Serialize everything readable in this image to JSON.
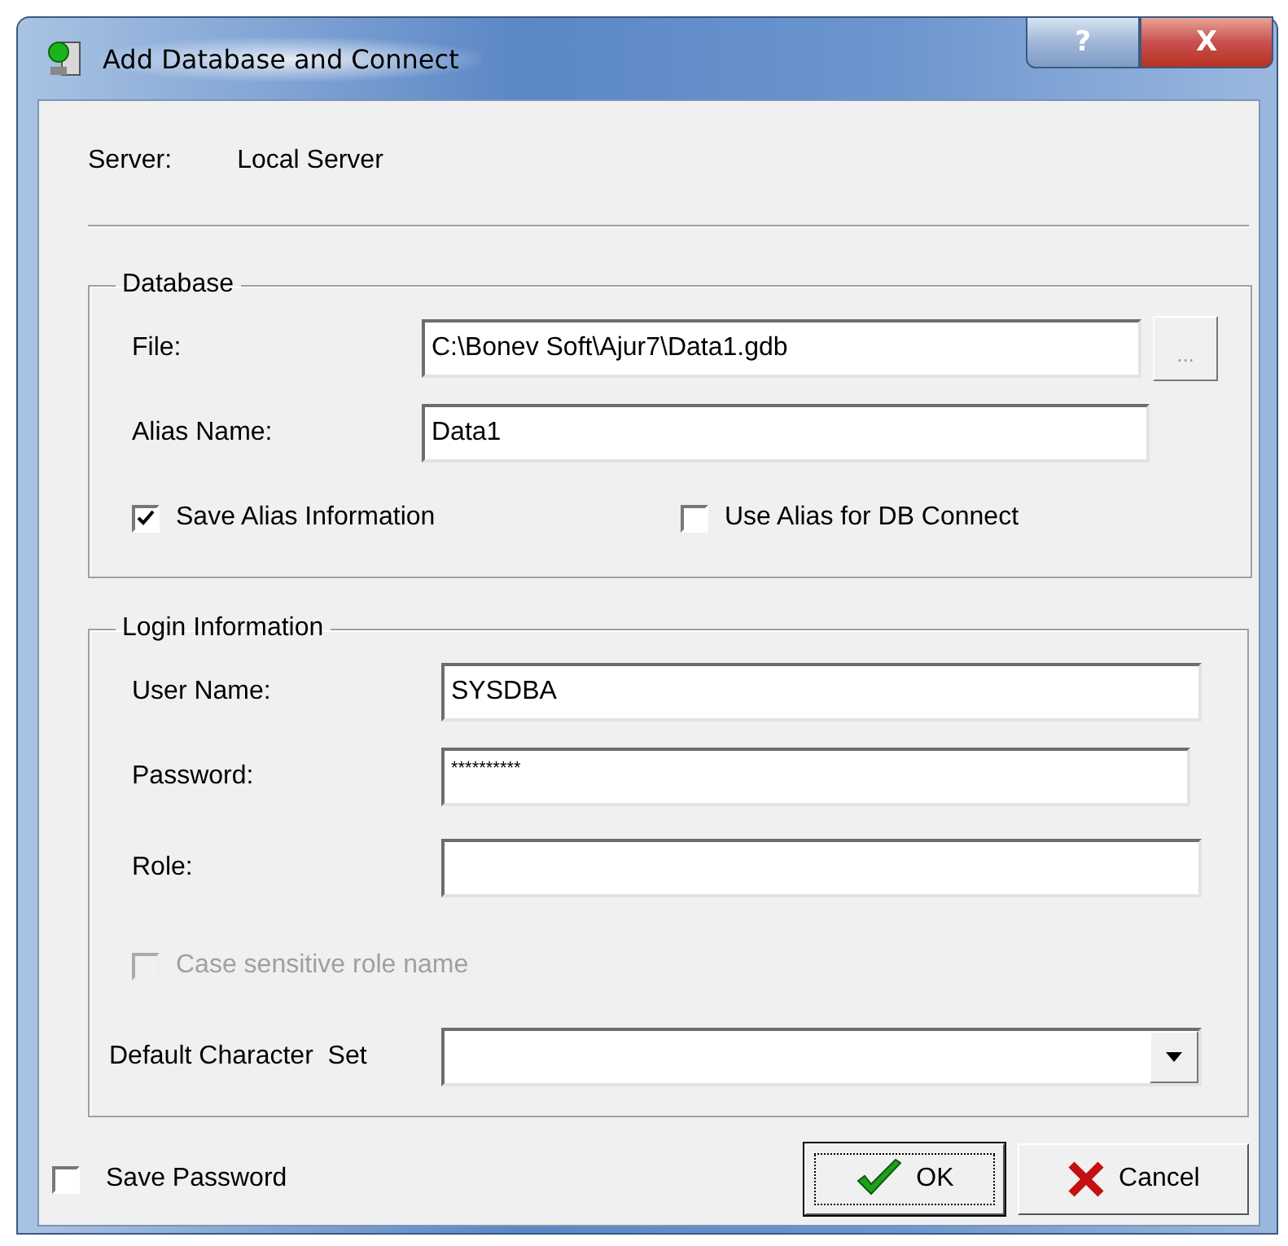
{
  "window": {
    "title": "Add Database and Connect",
    "help_button": "?",
    "close_button": "X"
  },
  "server": {
    "label": "Server:",
    "value": "Local Server"
  },
  "database": {
    "title": "Database",
    "file": {
      "label": "File:",
      "value": "C:\\Bonev Soft\\Ajur7\\Data1.gdb",
      "browse": "..."
    },
    "alias": {
      "label": "Alias Name:",
      "value": "Data1"
    },
    "options": [
      {
        "label": "Save Alias Information",
        "checked": true,
        "disabled": false
      },
      {
        "label": "Use Alias for DB Connect",
        "checked": false,
        "disabled": false
      }
    ]
  },
  "login": {
    "title": "Login Information",
    "fields": [
      {
        "label": "User Name:",
        "value": "SYSDBA"
      },
      {
        "label": "Password:",
        "value": "**********",
        "kind": "password"
      },
      {
        "label": "Role:"
      }
    ],
    "case_sensitive": {
      "label": "Case sensitive role name",
      "checked": false,
      "disabled": true
    },
    "charset": {
      "label": "Default Character  Set"
    }
  },
  "save_password": {
    "label": "Save Password",
    "checked": false,
    "disabled": false
  },
  "buttons": [
    {
      "label": "OK",
      "kind": "ok",
      "focused": true
    },
    {
      "label": "Cancel",
      "kind": "cancel",
      "focused": false
    }
  ]
}
